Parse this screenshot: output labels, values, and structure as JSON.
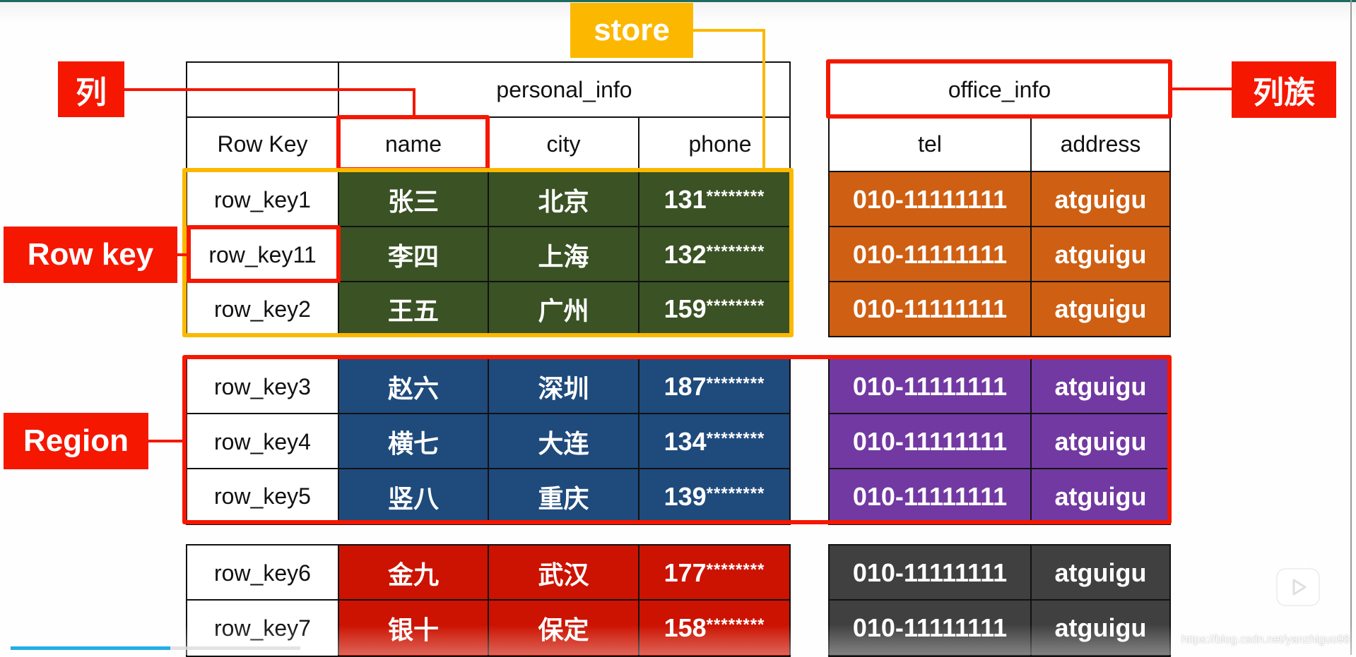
{
  "labels": {
    "column": "列",
    "column_family": "列族",
    "store": "store",
    "row_key": "Row key",
    "region": "Region"
  },
  "table": {
    "family_personal": "personal_info",
    "family_office": "office_info",
    "headers": {
      "row_key": "Row Key",
      "name": "name",
      "city": "city",
      "phone": "phone",
      "tel": "tel",
      "address": "address"
    },
    "rows": [
      {
        "key": "row_key1",
        "name": "张三",
        "city": "北京",
        "phone_prefix": "131",
        "phone_mask": "********",
        "tel": "010-11111111",
        "address": "atguigu"
      },
      {
        "key": "row_key11",
        "name": "李四",
        "city": "上海",
        "phone_prefix": "132",
        "phone_mask": "********",
        "tel": "010-11111111",
        "address": "atguigu"
      },
      {
        "key": "row_key2",
        "name": "王五",
        "city": "广州",
        "phone_prefix": "159",
        "phone_mask": "********",
        "tel": "010-11111111",
        "address": "atguigu"
      },
      {
        "key": "row_key3",
        "name": "赵六",
        "city": "深圳",
        "phone_prefix": "187",
        "phone_mask": "********",
        "tel": "010-11111111",
        "address": "atguigu"
      },
      {
        "key": "row_key4",
        "name": "横七",
        "city": "大连",
        "phone_prefix": "134",
        "phone_mask": "********",
        "tel": "010-11111111",
        "address": "atguigu"
      },
      {
        "key": "row_key5",
        "name": "竖八",
        "city": "重庆",
        "phone_prefix": "139",
        "phone_mask": "********",
        "tel": "010-11111111",
        "address": "atguigu"
      },
      {
        "key": "row_key6",
        "name": "金九",
        "city": "武汉",
        "phone_prefix": "177",
        "phone_mask": "********",
        "tel": "010-11111111",
        "address": "atguigu"
      },
      {
        "key": "row_key7",
        "name": "银十",
        "city": "保定",
        "phone_prefix": "158",
        "phone_mask": "********",
        "tel": "010-11111111",
        "address": "atguigu"
      }
    ]
  },
  "colors": {
    "annotation_red": "#f51700",
    "store_yellow": "#fcb800",
    "group1_personal": "#3a5224",
    "group1_office": "#cf5f12",
    "group2_personal": "#1f4a7c",
    "group2_office": "#7239a2",
    "group3_personal": "#cc1200",
    "group3_office": "#404040"
  },
  "player": {
    "progress": 0.55,
    "watermark": "https://blog.csdn.net/yanzhiguo98",
    "icon": "bilibili-tv-icon"
  }
}
